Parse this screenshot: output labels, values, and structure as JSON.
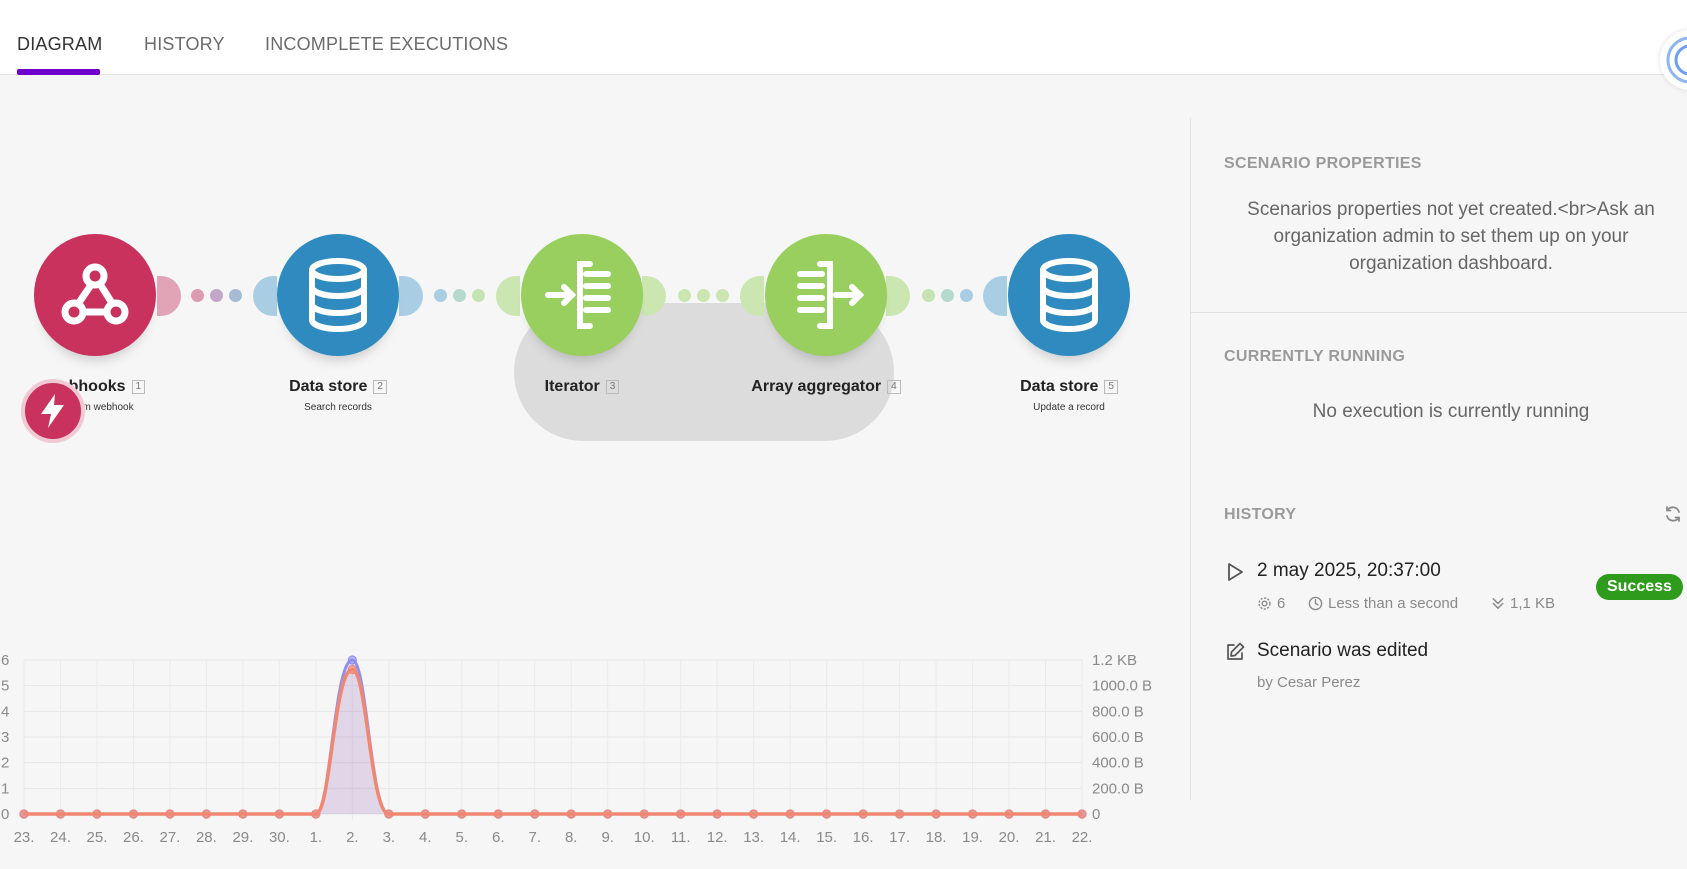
{
  "tabs": [
    {
      "label": "DIAGRAM",
      "active": true
    },
    {
      "label": "HISTORY",
      "active": false
    },
    {
      "label": "INCOMPLETE EXECUTIONS",
      "active": false
    }
  ],
  "modules": [
    {
      "name": "Webhooks",
      "number": "1",
      "subtitle": "Custom webhook",
      "icon": "webhook-icon",
      "color": "#c8325c"
    },
    {
      "name": "Data store",
      "number": "2",
      "subtitle": "Search records",
      "icon": "database-icon",
      "color": "#2f8bbf"
    },
    {
      "name": "Iterator",
      "number": "3",
      "subtitle": "",
      "icon": "iterator-icon",
      "color": "#98cf5e"
    },
    {
      "name": "Array aggregator",
      "number": "4",
      "subtitle": "",
      "icon": "aggregator-icon",
      "color": "#98cf5e"
    },
    {
      "name": "Data store",
      "number": "5",
      "subtitle": "Update a record",
      "icon": "database-icon",
      "color": "#2f8bbf"
    }
  ],
  "panel": {
    "properties": {
      "title": "SCENARIO PROPERTIES",
      "message": "Scenarios properties not yet created.<br>Ask an organization admin to set them up on your organization dashboard."
    },
    "running": {
      "title": "CURRENTLY RUNNING",
      "message": "No execution is currently running"
    },
    "history": {
      "title": "HISTORY",
      "run": {
        "datetime": "2 may 2025, 20:37:00",
        "operations": "6",
        "duration": "Less than a second",
        "size": "1,1 KB",
        "status": "Success",
        "status_color": "#2e9b1d"
      },
      "edit": {
        "title": "Scenario was edited",
        "by": "by Cesar Perez"
      }
    }
  },
  "chart_data": {
    "type": "area",
    "x": [
      "23.",
      "24.",
      "25.",
      "26.",
      "27.",
      "28.",
      "29.",
      "30.",
      "1.",
      "2.",
      "3.",
      "4.",
      "5.",
      "6.",
      "7.",
      "8.",
      "9.",
      "10.",
      "11.",
      "12.",
      "13.",
      "14.",
      "15.",
      "16.",
      "17.",
      "18.",
      "19.",
      "20.",
      "21.",
      "22."
    ],
    "series": [
      {
        "values": [
          0,
          0,
          0,
          0,
          0,
          0,
          0,
          0,
          0,
          6,
          0,
          0,
          0,
          0,
          0,
          0,
          0,
          0,
          0,
          0,
          0,
          0,
          0,
          0,
          0,
          0,
          0,
          0,
          0,
          0
        ],
        "color": "#8f8ff0",
        "axis": "left"
      },
      {
        "values": [
          0,
          0,
          0,
          0,
          0,
          0,
          0,
          0,
          0,
          1126,
          0,
          0,
          0,
          0,
          0,
          0,
          0,
          0,
          0,
          0,
          0,
          0,
          0,
          0,
          0,
          0,
          0,
          0,
          0,
          0
        ],
        "color": "#f08772",
        "axis": "right"
      }
    ],
    "y_left_ticks": [
      "6",
      "5",
      "4",
      "3",
      "2",
      "1",
      "0"
    ],
    "y_right_ticks": [
      "1.2 KB",
      "1000.0 B",
      "800.0 B",
      "600.0 B",
      "400.0 B",
      "200.0 B",
      "0"
    ],
    "ylim_left": [
      0,
      6
    ],
    "ylim_right": [
      0,
      1200
    ],
    "grid": true
  }
}
